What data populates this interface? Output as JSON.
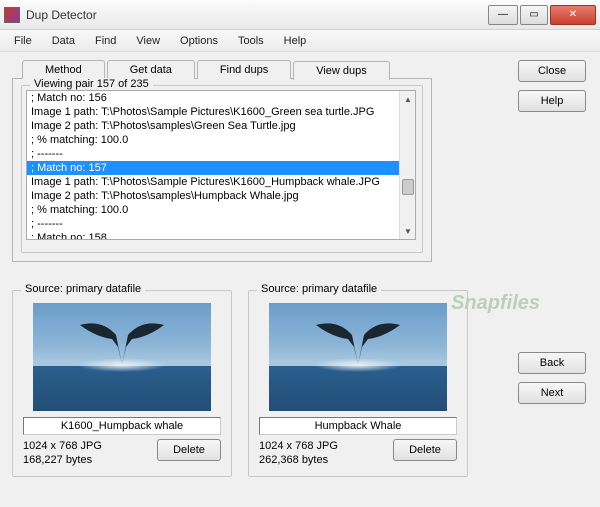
{
  "window": {
    "title": "Dup Detector"
  },
  "menu": {
    "items": [
      "File",
      "Data",
      "Find",
      "View",
      "Options",
      "Tools",
      "Help"
    ]
  },
  "tabs": {
    "items": [
      "Method",
      "Get data",
      "Find dups",
      "View dups"
    ],
    "active": 3
  },
  "viewing": {
    "legend": "Viewing pair 157 of 235"
  },
  "list": {
    "lines": [
      "; Match no: 156",
      "Image 1 path: T:\\Photos\\Sample Pictures\\K1600_Green sea turtle.JPG",
      "Image 2 path: T:\\Photos\\samples\\Green Sea Turtle.jpg",
      "; % matching: 100.0",
      "; -------",
      "; Match no: 157",
      "Image 1 path: T:\\Photos\\Sample Pictures\\K1600_Humpback whale.JPG",
      "Image 2 path: T:\\Photos\\samples\\Humpback Whale.jpg",
      "; % matching: 100.0",
      "; -------",
      "; Match no: 158"
    ],
    "selected_index": 5
  },
  "buttons": {
    "close": "Close",
    "help": "Help",
    "back": "Back",
    "next": "Next",
    "delete": "Delete"
  },
  "preview1": {
    "source_label": "Source: primary datafile",
    "filename": "K1600_Humpback whale",
    "dims": "1024 x 768 JPG",
    "size": "168,227 bytes"
  },
  "preview2": {
    "source_label": "Source: primary datafile",
    "filename": "Humpback Whale",
    "dims": "1024 x 768 JPG",
    "size": "262,368 bytes"
  },
  "watermark": "Snapfiles"
}
